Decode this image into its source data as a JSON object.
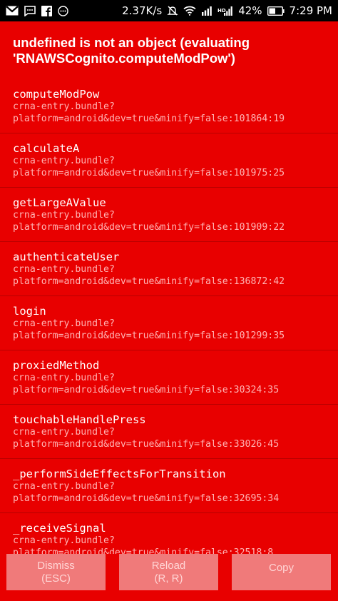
{
  "status_bar": {
    "network_speed": "2.37K/s",
    "battery_percent": "42%",
    "time": "7:29 PM",
    "icons": [
      "gmail-icon",
      "message-icon",
      "facebook-icon",
      "more-icon",
      "mute-icon",
      "wifi-icon",
      "signal-icon",
      "hd-signal-icon",
      "battery-icon"
    ]
  },
  "error": {
    "title": "undefined is not an object (evaluating 'RNAWSCognito.computeModPow')"
  },
  "stack": [
    {
      "method": "computeModPow",
      "file_line1": "crna-entry.bundle?",
      "file_line2": "platform=android&dev=true&minify=false:101864:19"
    },
    {
      "method": "calculateA",
      "file_line1": "crna-entry.bundle?",
      "file_line2": "platform=android&dev=true&minify=false:101975:25"
    },
    {
      "method": "getLargeAValue",
      "file_line1": "crna-entry.bundle?",
      "file_line2": "platform=android&dev=true&minify=false:101909:22"
    },
    {
      "method": "authenticateUser",
      "file_line1": "crna-entry.bundle?",
      "file_line2": "platform=android&dev=true&minify=false:136872:42"
    },
    {
      "method": "login",
      "file_line1": "crna-entry.bundle?",
      "file_line2": "platform=android&dev=true&minify=false:101299:35"
    },
    {
      "method": "proxiedMethod",
      "file_line1": "crna-entry.bundle?",
      "file_line2": "platform=android&dev=true&minify=false:30324:35"
    },
    {
      "method": "touchableHandlePress",
      "file_line1": "crna-entry.bundle?",
      "file_line2": "platform=android&dev=true&minify=false:33026:45"
    },
    {
      "method": "_performSideEffectsForTransition",
      "file_line1": "crna-entry.bundle?",
      "file_line2": "platform=android&dev=true&minify=false:32695:34"
    },
    {
      "method": "_receiveSignal",
      "file_line1": "crna-entry.bundle?",
      "file_line2": "platform=android&dev=true&minify=false:32518:8"
    }
  ],
  "buttons": {
    "dismiss_line1": "Dismiss",
    "dismiss_line2": "(ESC)",
    "reload_line1": "Reload",
    "reload_line2": "(R, R)",
    "copy_label": "Copy"
  },
  "colors": {
    "background": "#e80000",
    "button_bg": "#f07a7a",
    "button_text": "#ffd6d6",
    "file_text": "#ffb3b3"
  }
}
